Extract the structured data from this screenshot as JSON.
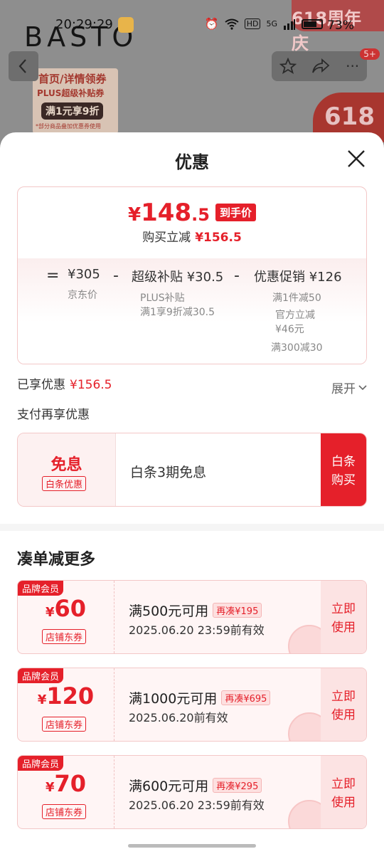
{
  "status": {
    "time": "20:29:29",
    "battery": "73%",
    "hd": "HD",
    "net": "5G"
  },
  "background": {
    "logo": "BASTO",
    "banner": "618周年庆",
    "promo": {
      "line1": "首页/详情领券",
      "line2": "PLUS超级补贴券",
      "line3": "满1元享9折",
      "line4": "*部分商品叠加优惠券使用"
    },
    "badge_618": "618",
    "nav_badge": "5+"
  },
  "sheet": {
    "title": "优惠",
    "price": {
      "currency": "¥",
      "integer": "148",
      "decimal": ".5",
      "tag": "到手价",
      "reduce_label": "购买立减",
      "reduce_value": "¥156.5"
    },
    "breakdown": {
      "op_eq": "=",
      "op_minus": "-",
      "jd_price": "¥305",
      "jd_label": "京东价",
      "subsidy": "超级补贴 ¥30.5",
      "subsidy_sub1": "PLUS补贴",
      "subsidy_sub2": "满1享9折减30.5",
      "promo": "优惠促销 ¥126",
      "promo_sub1": "满1件减50",
      "promo_sub2": "官方立减",
      "promo_sub3": "¥46元",
      "promo_sub4": "满300减30"
    },
    "saved_label": "已享优惠",
    "saved_value": "¥156.5",
    "expand_label": "展开",
    "pay_title": "支付再享优惠",
    "baitiao": {
      "free": "免息",
      "tag": "白条优惠",
      "text": "白条3期免息",
      "btn_line1": "白条",
      "btn_line2": "购买"
    },
    "more_title": "凑单减更多",
    "coupons": [
      {
        "badge": "品牌会员",
        "currency": "¥",
        "amount": "60",
        "tag": "店铺东券",
        "cond": "满500元可用",
        "extra": "再凑¥195",
        "expiry": "2025.06.20 23:59前有效",
        "use1": "立即",
        "use2": "使用"
      },
      {
        "badge": "品牌会员",
        "currency": "¥",
        "amount": "120",
        "tag": "店铺东券",
        "cond": "满1000元可用",
        "extra": "再凑¥695",
        "expiry": "2025.06.20前有效",
        "use1": "立即",
        "use2": "使用"
      },
      {
        "badge": "品牌会员",
        "currency": "¥",
        "amount": "70",
        "tag": "店铺东券",
        "cond": "满600元可用",
        "extra": "再凑¥295",
        "expiry": "2025.06.20 23:59前有效",
        "use1": "立即",
        "use2": "使用"
      }
    ]
  }
}
